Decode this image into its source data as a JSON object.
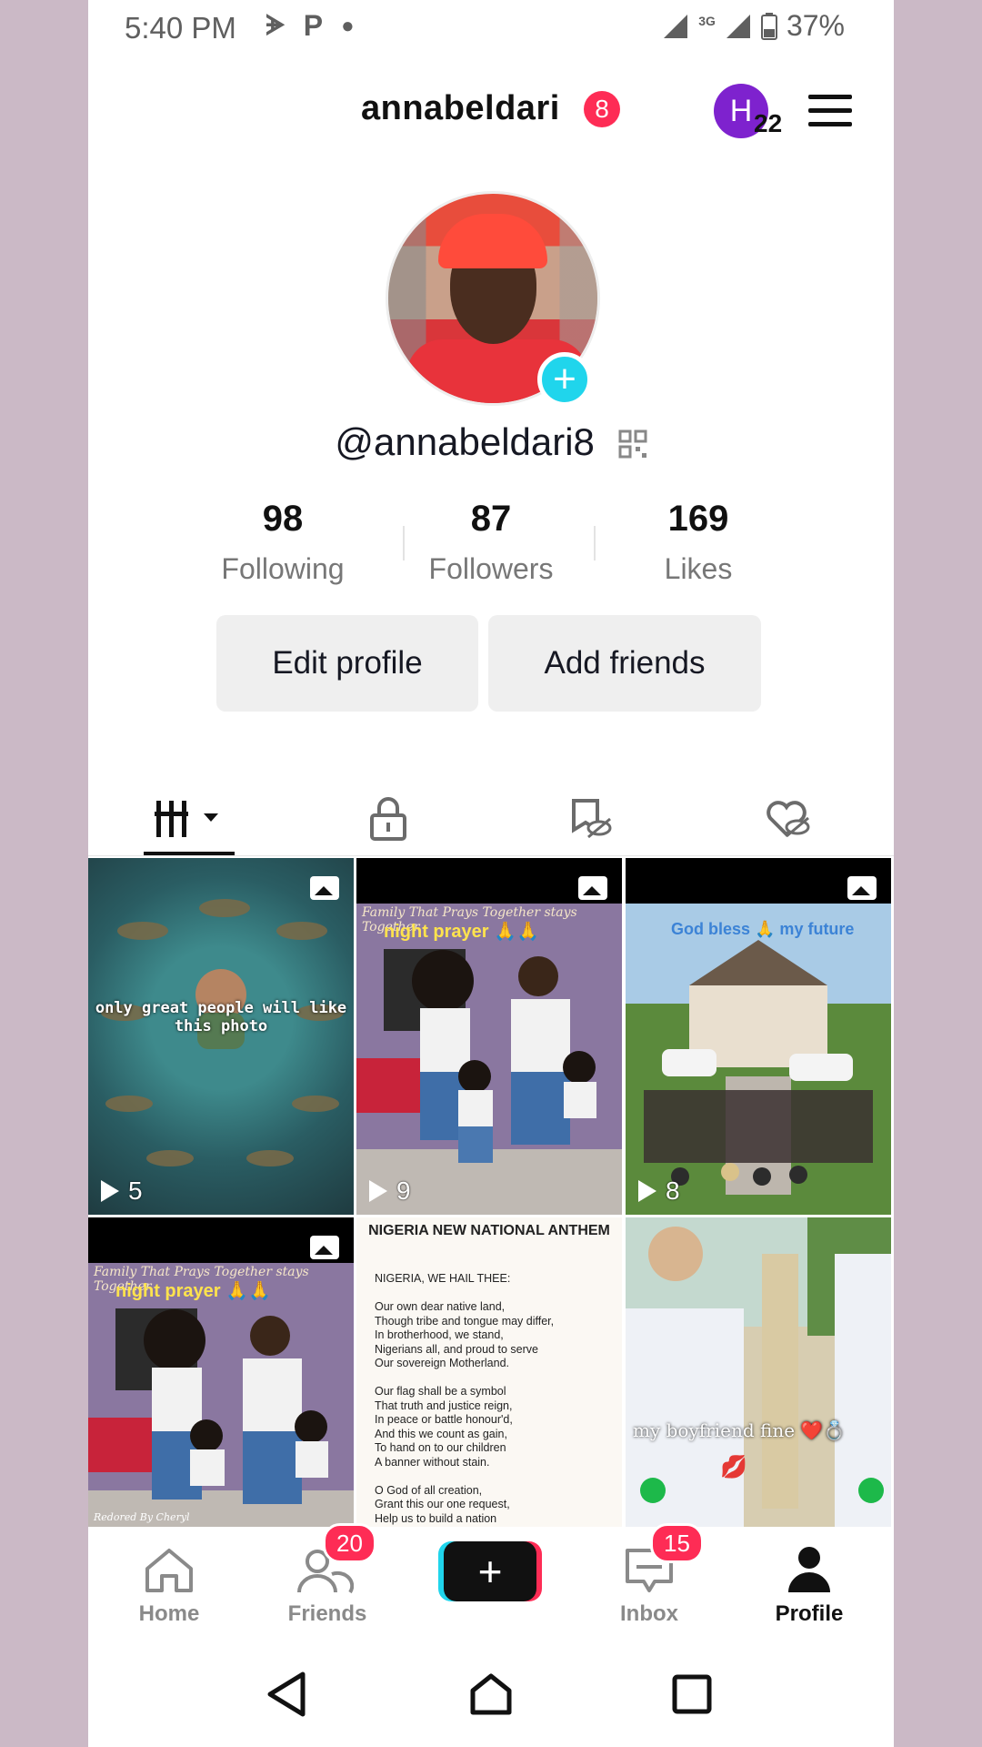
{
  "status_bar": {
    "time": "5:40 PM",
    "network": "3G",
    "battery": "37%"
  },
  "header": {
    "username": "annabeldari",
    "username_badge": "8",
    "account_initial": "H",
    "account_count": "22"
  },
  "profile": {
    "handle": "@annabeldari8",
    "stats": [
      {
        "value": "98",
        "label": "Following"
      },
      {
        "value": "87",
        "label": "Followers"
      },
      {
        "value": "169",
        "label": "Likes"
      }
    ],
    "edit_button": "Edit profile",
    "add_friends_button": "Add friends"
  },
  "tabs": [
    {
      "icon": "videos-grid-icon",
      "active": true
    },
    {
      "icon": "lock-icon",
      "active": false
    },
    {
      "icon": "favorites-hidden-icon",
      "active": false
    },
    {
      "icon": "liked-hidden-icon",
      "active": false
    }
  ],
  "grid": [
    {
      "caption": "only great people will like this photo",
      "plays": "5"
    },
    {
      "script": "Family That Prays Together stays Together",
      "caption": "night prayer 🙏🙏",
      "plays": "9"
    },
    {
      "caption": "God bless 🙏 my future",
      "plays": "8"
    },
    {
      "script": "Family That Prays Together stays Together",
      "caption": "night prayer 🙏🙏",
      "footer": "Redored By Cheryl"
    },
    {
      "title": "NIGERIA NEW NATIONAL ANTHEM",
      "body": "NIGERIA, WE HAIL THEE:\n\nOur own dear native land,\nThough tribe and tongue may differ,\nIn brotherhood, we stand,\nNigerians all, and proud to serve\nOur sovereign Motherland.\n\nOur flag shall be a symbol\nThat truth and justice reign,\nIn peace or battle honour'd,\nAnd this we count as gain,\nTo hand on to our children\nA banner without stain.\n\nO God of all creation,\nGrant this our one request,\nHelp us to build a nation\nWhere no man is oppressed,\nAnd so with peace and plenty"
    },
    {
      "caption": "my boyfriend fine ❤️💍",
      "emoji": "💋"
    }
  ],
  "nav": {
    "home": "Home",
    "friends": "Friends",
    "friends_badge": "20",
    "inbox": "Inbox",
    "inbox_badge": "15",
    "profile": "Profile"
  },
  "colors": {
    "accent_red": "#fe2c55",
    "accent_cyan": "#20d5ec",
    "account_purple": "#7e22ce"
  }
}
